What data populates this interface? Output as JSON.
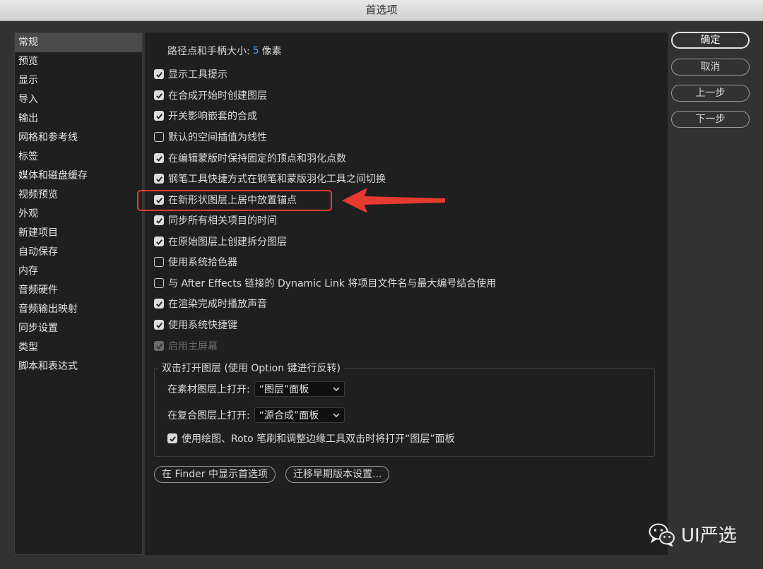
{
  "window": {
    "title": "首选项"
  },
  "sidebar": {
    "items": [
      {
        "label": "常规",
        "selected": true
      },
      {
        "label": "预览"
      },
      {
        "label": "显示"
      },
      {
        "label": "导入"
      },
      {
        "label": "输出"
      },
      {
        "label": "网格和参考线"
      },
      {
        "label": "标签"
      },
      {
        "label": "媒体和磁盘缓存"
      },
      {
        "label": "视频预览"
      },
      {
        "label": "外观"
      },
      {
        "label": "新建项目"
      },
      {
        "label": "自动保存"
      },
      {
        "label": "内存"
      },
      {
        "label": "音频硬件"
      },
      {
        "label": "音频输出映射"
      },
      {
        "label": "同步设置"
      },
      {
        "label": "类型"
      },
      {
        "label": "脚本和表达式"
      }
    ]
  },
  "general": {
    "path_point_label": "路径点和手柄大小:",
    "path_point_value": "5",
    "path_point_unit": "像素",
    "options": [
      {
        "label": "显示工具提示",
        "checked": true
      },
      {
        "label": "在合成开始时创建图层",
        "checked": true
      },
      {
        "label": "开关影响嵌套的合成",
        "checked": true
      },
      {
        "label": "默认的空间插值为线性",
        "checked": false
      },
      {
        "label": "在编辑蒙版时保持固定的顶点和羽化点数",
        "checked": true
      },
      {
        "label": "钢笔工具快捷方式在钢笔和蒙版羽化工具之间切换",
        "checked": true
      },
      {
        "label": "在新形状图层上居中放置锚点",
        "checked": true
      },
      {
        "label": "同步所有相关项目的时间",
        "checked": true
      },
      {
        "label": "在原始图层上创建拆分图层",
        "checked": true
      },
      {
        "label": "使用系统拾色器",
        "checked": false
      },
      {
        "label": "与 After Effects 链接的 Dynamic Link 将项目文件名与最大编号结合使用",
        "checked": false
      },
      {
        "label": "在渲染完成时播放声音",
        "checked": true
      },
      {
        "label": "使用系统快捷键",
        "checked": true
      },
      {
        "label": "启用主屏幕",
        "checked": true,
        "disabled": true
      }
    ]
  },
  "double_click": {
    "group_title": "双击打开图层 (使用 Option 键进行反转)",
    "footage_label": "在素材图层上打开:",
    "footage_value": "“图层”面板",
    "comp_label": "在复合图层上打开:",
    "comp_value": "“源合成”面板",
    "paint_option": {
      "label": "使用绘图、Roto 笔刷和调整边缘工具双击时将打开“图层”面板",
      "checked": true
    }
  },
  "buttons": {
    "ok": "确定",
    "cancel": "取消",
    "previous": "上一步",
    "next": "下一步",
    "show_in_finder": "在 Finder 中显示首选项",
    "migrate": "迁移早期版本设置..."
  },
  "watermark": {
    "text": "UI严选",
    "icon": "wechat-icon"
  },
  "annotation": {
    "color": "#e53a2e"
  },
  "colors": {
    "accent": "#4aa3ff",
    "background": "#323232",
    "panel": "#1f1f1f"
  }
}
